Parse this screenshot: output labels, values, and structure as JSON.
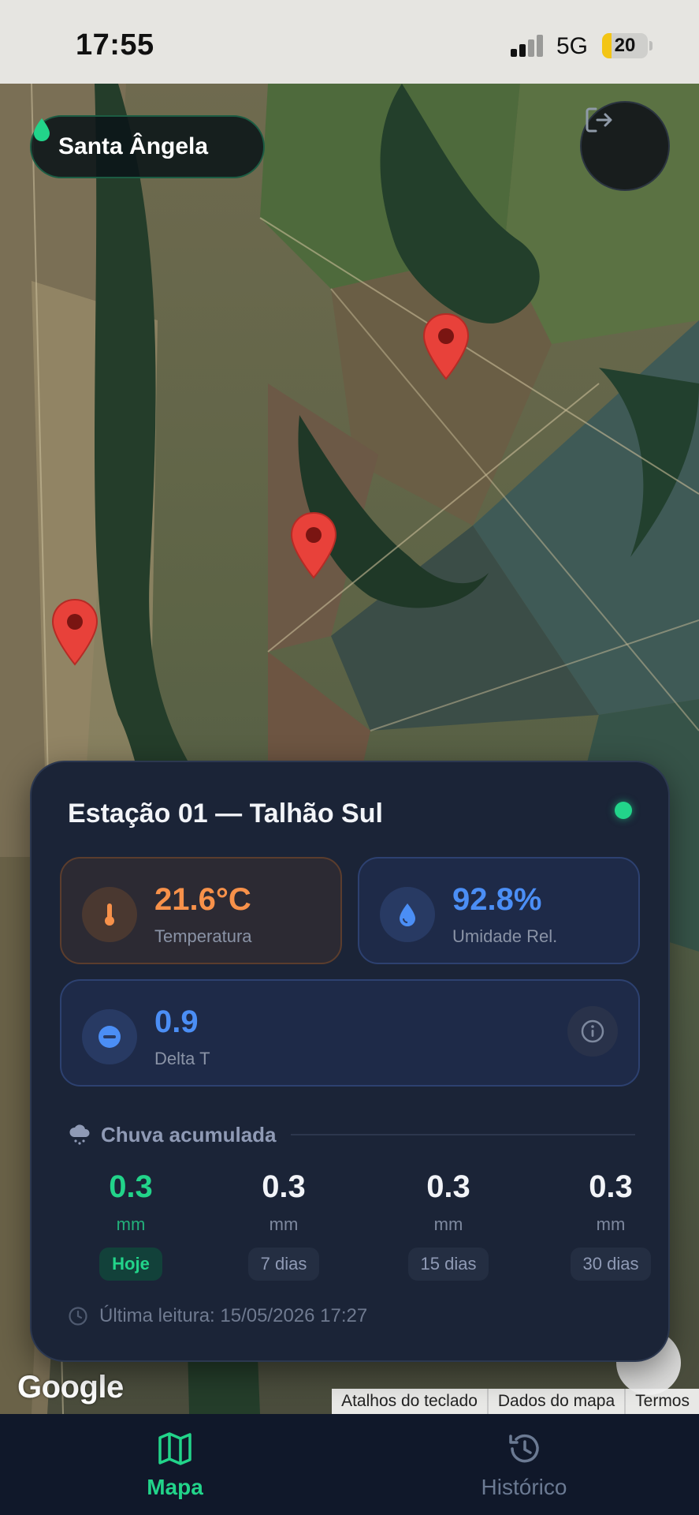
{
  "status_bar": {
    "time": "17:55",
    "network": "5G",
    "battery": "20",
    "battery_level": 0.2
  },
  "map": {
    "location_label": "Santa Ângela",
    "attribution": "Google",
    "links": [
      "Atalhos do teclado",
      "Dados do mapa",
      "Termos"
    ],
    "pin_color": "#e8413a"
  },
  "station": {
    "title": "Estação 01 — Talhão Sul",
    "status_color": "#22d48a",
    "temperature": {
      "value": "21.6°C",
      "label": "Temperatura",
      "color": "#f7914a"
    },
    "humidity": {
      "value": "92.8%",
      "label": "Umidade Rel.",
      "color": "#4b8ef5"
    },
    "delta_t": {
      "value": "0.9",
      "label": "Delta T"
    },
    "rain": {
      "title": "Chuva acumulada",
      "periods": [
        {
          "value": "0.3",
          "unit": "mm",
          "period": "Hoje"
        },
        {
          "value": "0.3",
          "unit": "mm",
          "period": "7 dias"
        },
        {
          "value": "0.3",
          "unit": "mm",
          "period": "15 dias"
        },
        {
          "value": "0.3",
          "unit": "mm",
          "period": "30 dias"
        }
      ]
    },
    "last_reading": "Última leitura: 15/05/2026 17:27"
  },
  "nav": {
    "items": [
      {
        "label": "Mapa",
        "icon": "map-icon",
        "active": true
      },
      {
        "label": "Histórico",
        "icon": "history-icon",
        "active": false
      }
    ]
  }
}
